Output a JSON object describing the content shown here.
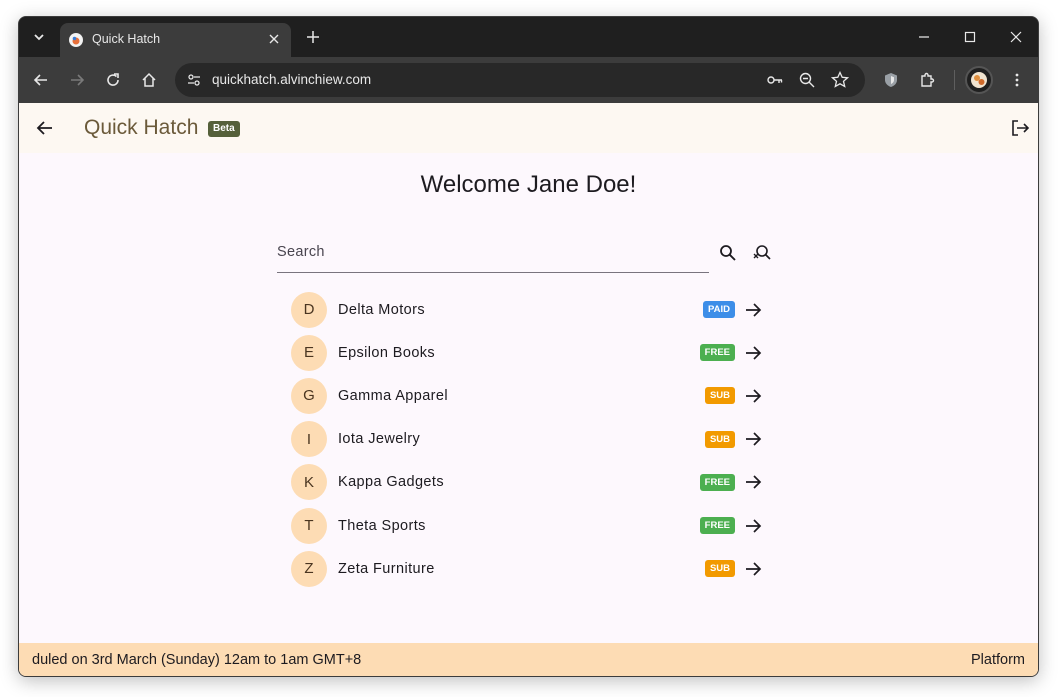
{
  "browser": {
    "tab_title": "Quick Hatch",
    "url": "quickhatch.alvinchiew.com"
  },
  "app": {
    "title": "Quick Hatch",
    "badge": "Beta"
  },
  "welcome": "Welcome Jane Doe!",
  "search": {
    "placeholder": "Search",
    "value": ""
  },
  "merchants": [
    {
      "initial": "D",
      "name": "Delta Motors",
      "plan": "PAID",
      "plan_color": "#3d8ee8"
    },
    {
      "initial": "E",
      "name": "Epsilon Books",
      "plan": "FREE",
      "plan_color": "#4caf50"
    },
    {
      "initial": "G",
      "name": "Gamma Apparel",
      "plan": "SUB",
      "plan_color": "#f29a00"
    },
    {
      "initial": "I",
      "name": "Iota Jewelry",
      "plan": "SUB",
      "plan_color": "#f29a00"
    },
    {
      "initial": "K",
      "name": "Kappa Gadgets",
      "plan": "FREE",
      "plan_color": "#4caf50"
    },
    {
      "initial": "T",
      "name": "Theta Sports",
      "plan": "FREE",
      "plan_color": "#4caf50"
    },
    {
      "initial": "Z",
      "name": "Zeta Furniture",
      "plan": "SUB",
      "plan_color": "#f29a00"
    }
  ],
  "footer": {
    "marquee": "duled on 3rd March (Sunday) 12am to 1am GMT+8",
    "right_label": "Platform"
  },
  "icons": {
    "back": "arrow-left-icon",
    "logout": "logout-icon",
    "search": "search-icon",
    "clear_search": "search-off-icon",
    "row_arrow": "arrow-right-icon"
  },
  "colors": {
    "appbar_bg": "#fdf8f2",
    "page_bg": "#fdf8fd",
    "avatar_bg": "#fddcb4",
    "footer_bg": "#fddcb4",
    "title_color": "#6b5a3a",
    "beta_bg": "#55603a"
  }
}
